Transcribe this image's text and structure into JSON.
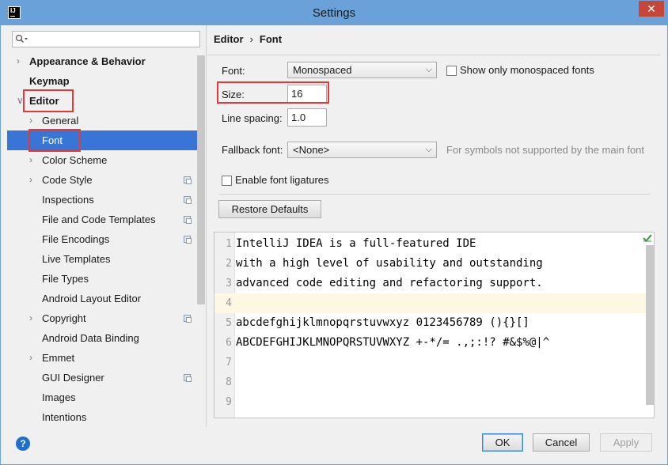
{
  "window": {
    "title": "Settings",
    "app_icon_text": "IJ",
    "close_glyph": "✕"
  },
  "search": {
    "placeholder": "",
    "value": ""
  },
  "tree": [
    {
      "label": "Appearance & Behavior",
      "bold": true,
      "chevron": true,
      "indent": 0,
      "copy": false
    },
    {
      "label": "Keymap",
      "bold": true,
      "chevron": false,
      "indent": 0,
      "copy": false
    },
    {
      "label": "Editor",
      "bold": true,
      "chevron": true,
      "expanded": true,
      "indent": 0,
      "copy": false
    },
    {
      "label": "General",
      "bold": false,
      "chevron": true,
      "indent": 1,
      "copy": false
    },
    {
      "label": "Font",
      "bold": false,
      "chevron": false,
      "indent": 1,
      "selected": true,
      "copy": false
    },
    {
      "label": "Color Scheme",
      "bold": false,
      "chevron": true,
      "indent": 1,
      "copy": false
    },
    {
      "label": "Code Style",
      "bold": false,
      "chevron": true,
      "indent": 1,
      "copy": true
    },
    {
      "label": "Inspections",
      "bold": false,
      "chevron": false,
      "indent": 1,
      "copy": true
    },
    {
      "label": "File and Code Templates",
      "bold": false,
      "chevron": false,
      "indent": 1,
      "copy": true
    },
    {
      "label": "File Encodings",
      "bold": false,
      "chevron": false,
      "indent": 1,
      "copy": true
    },
    {
      "label": "Live Templates",
      "bold": false,
      "chevron": false,
      "indent": 1,
      "copy": false
    },
    {
      "label": "File Types",
      "bold": false,
      "chevron": false,
      "indent": 1,
      "copy": false
    },
    {
      "label": "Android Layout Editor",
      "bold": false,
      "chevron": false,
      "indent": 1,
      "copy": false
    },
    {
      "label": "Copyright",
      "bold": false,
      "chevron": true,
      "indent": 1,
      "copy": true
    },
    {
      "label": "Android Data Binding",
      "bold": false,
      "chevron": false,
      "indent": 1,
      "copy": false
    },
    {
      "label": "Emmet",
      "bold": false,
      "chevron": true,
      "indent": 1,
      "copy": false
    },
    {
      "label": "GUI Designer",
      "bold": false,
      "chevron": false,
      "indent": 1,
      "copy": true
    },
    {
      "label": "Images",
      "bold": false,
      "chevron": false,
      "indent": 1,
      "copy": false
    },
    {
      "label": "Intentions",
      "bold": false,
      "chevron": false,
      "indent": 1,
      "copy": false
    }
  ],
  "breadcrumb": {
    "parent": "Editor",
    "separator": "›",
    "current": "Font"
  },
  "font": {
    "font_label": "Font:",
    "font_value": "Monospaced",
    "show_mono_label": "Show only monospaced fonts",
    "show_mono_checked": false,
    "size_label": "Size:",
    "size_value": "16",
    "line_spacing_label": "Line spacing:",
    "line_spacing_value": "1.0",
    "fallback_label": "Fallback font:",
    "fallback_value": "<None>",
    "fallback_hint": "For symbols not supported by the main font",
    "ligatures_label": "Enable font ligatures",
    "ligatures_checked": false,
    "restore_label": "Restore Defaults"
  },
  "preview": {
    "lines": [
      {
        "n": "1",
        "text": "IntelliJ IDEA is a full-featured IDE"
      },
      {
        "n": "2",
        "text": "with a high level of usability and outstanding"
      },
      {
        "n": "3",
        "text": "advanced code editing and refactoring support."
      },
      {
        "n": "4",
        "text": ""
      },
      {
        "n": "5",
        "text": "abcdefghijklmnopqrstuvwxyz 0123456789 (){}[]"
      },
      {
        "n": "6",
        "text": "ABCDEFGHIJKLMNOPQRSTUVWXYZ +-*/= .,;:!? #&$%@|^"
      },
      {
        "n": "7",
        "text": ""
      },
      {
        "n": "8",
        "text": ""
      },
      {
        "n": "9",
        "text": ""
      }
    ],
    "current_line": "4"
  },
  "footer": {
    "help_glyph": "?",
    "ok_label": "OK",
    "cancel_label": "Cancel",
    "apply_label": "Apply"
  },
  "colors": {
    "accent": "#3875d7",
    "highlight_box": "#e53935",
    "title_bar": "#6aa1d8"
  }
}
